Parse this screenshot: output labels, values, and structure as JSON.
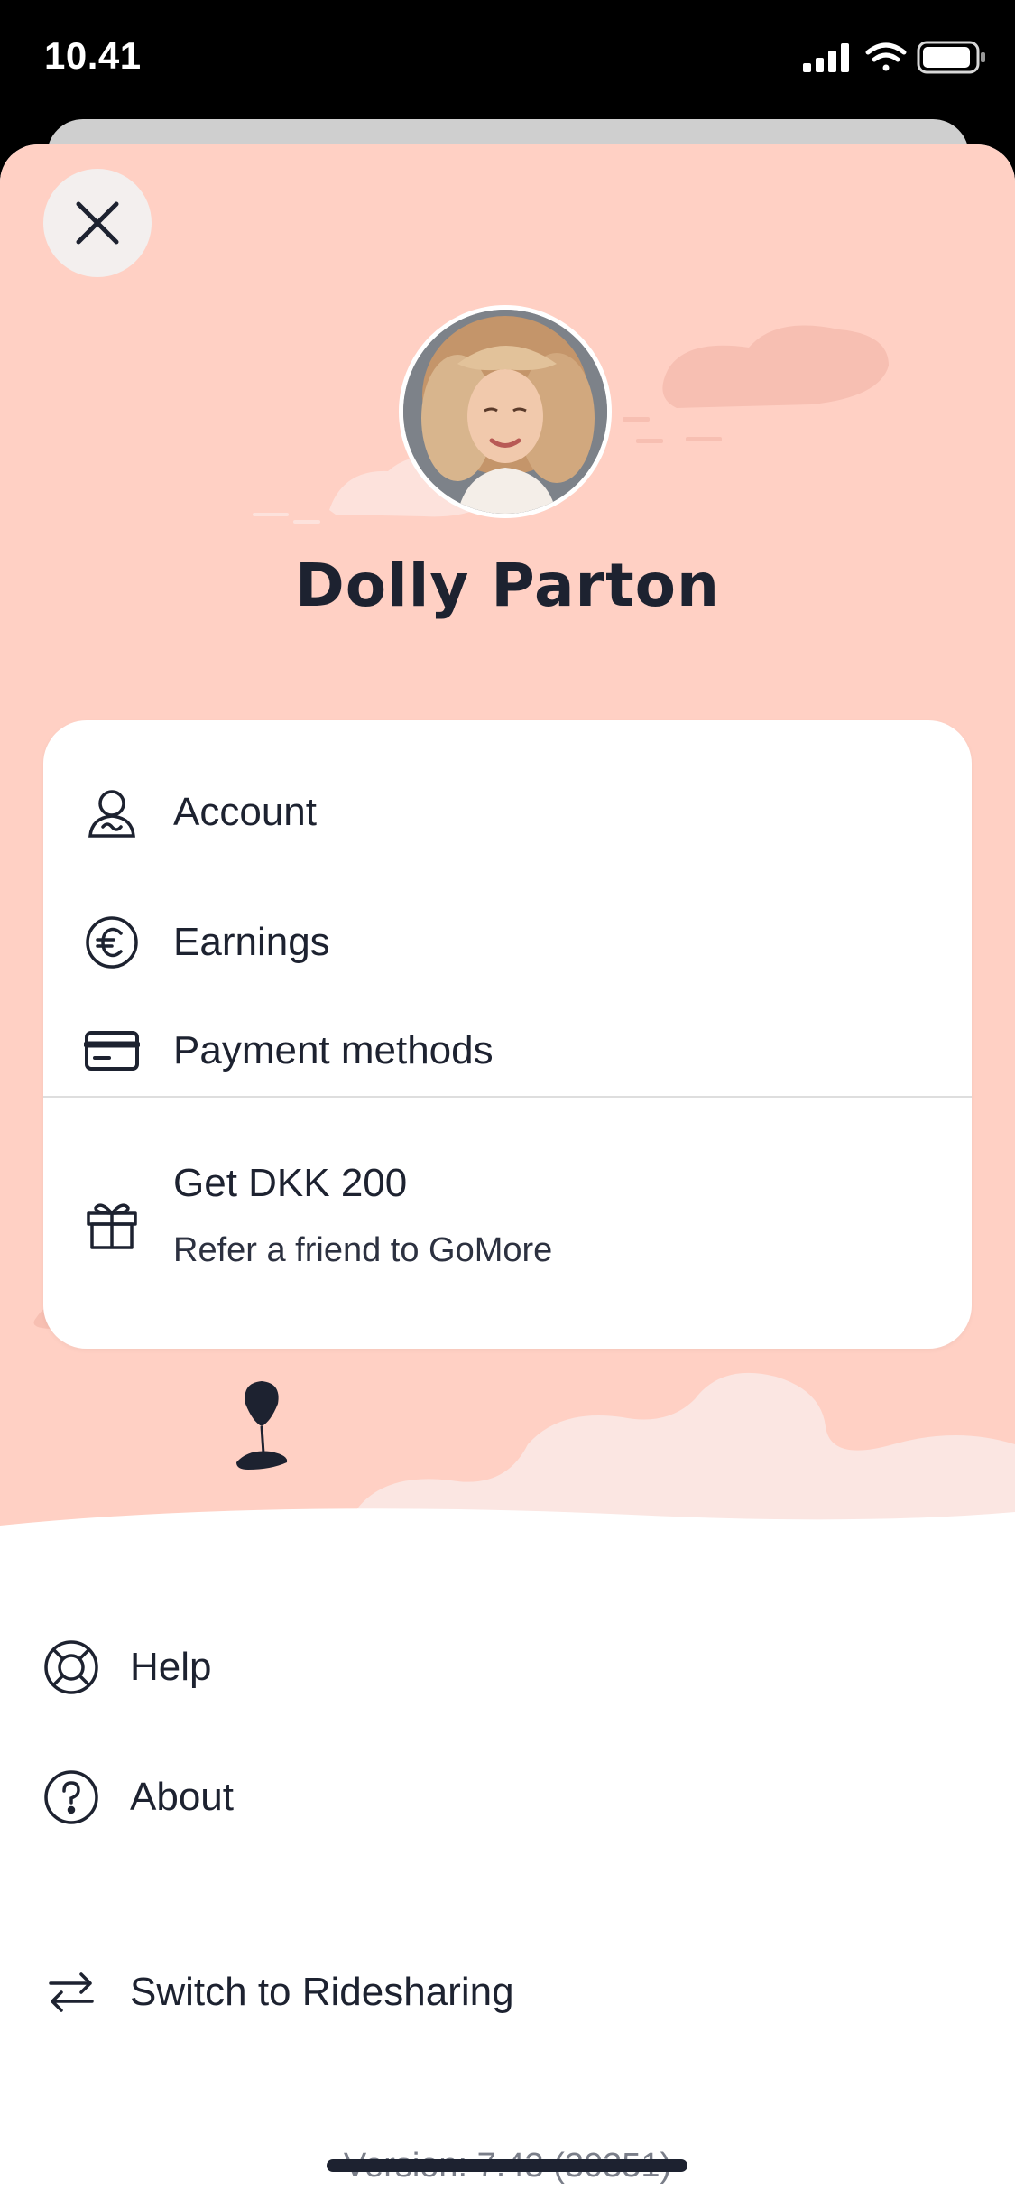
{
  "status_bar": {
    "time": "10.41"
  },
  "profile": {
    "name": "Dolly Parton"
  },
  "card_menu": {
    "items": [
      {
        "label": "Account",
        "icon": "user-icon"
      },
      {
        "label": "Earnings",
        "icon": "euro-icon"
      },
      {
        "label": "Payment methods",
        "icon": "credit-card-icon"
      }
    ],
    "referral": {
      "title": "Get DKK 200",
      "subtitle": "Refer a friend to GoMore",
      "icon": "gift-icon"
    }
  },
  "bottom_menu": {
    "items": [
      {
        "label": "Help",
        "icon": "lifebuoy-icon"
      },
      {
        "label": "About",
        "icon": "question-icon"
      },
      {
        "label": "Switch to Ridesharing",
        "icon": "swap-arrows-icon"
      }
    ]
  },
  "footer": {
    "version": "Version: 7.43 (30351)"
  },
  "colors": {
    "hero_background": "#ffd0c4",
    "text": "#1d2230",
    "card": "#ffffff"
  }
}
